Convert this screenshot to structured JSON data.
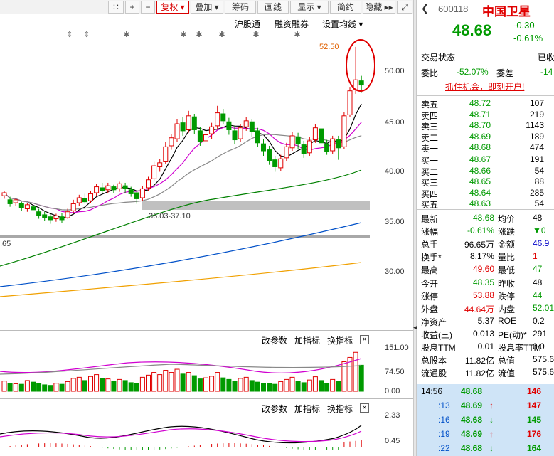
{
  "toolbar": {
    "buttons": [
      "+",
      "−",
      "复权 ▾",
      "叠加 ▾",
      "筹码",
      "画线",
      "显示 ▾",
      "简约",
      "隐藏 ▸▸"
    ],
    "menu_icon": "∷"
  },
  "chart_header": {
    "items": [
      "沪股通",
      "融资融券",
      "设置均线 ▾"
    ],
    "stars": [
      "⇕",
      "⇕",
      "✱",
      "✱",
      "✱",
      "✱",
      "✱",
      "✱"
    ]
  },
  "price_chart": {
    "y_ticks": [
      "50.00",
      "45.00",
      "40.00",
      "35.00",
      "30.00"
    ],
    "high_label": "52.50",
    "range_label": "36.03-37.10",
    "left_label": ".65"
  },
  "volume_panel": {
    "buttons": [
      "改参数",
      "加指标",
      "换指标"
    ],
    "close": "×",
    "y_ticks": [
      "151.00",
      "74.50",
      "0.00"
    ]
  },
  "macd_panel": {
    "buttons": [
      "改参数",
      "加指标",
      "换指标"
    ],
    "close": "×",
    "y_ticks": [
      "2.33",
      "0.45"
    ]
  },
  "stock": {
    "code": "600118",
    "name": "中国卫星",
    "price": "48.68",
    "change": "-0.30",
    "change_pct": "-0.61%"
  },
  "status": {
    "label": "交易状态",
    "value": "已收",
    "weibi_label": "委比",
    "weibi": "-52.07%",
    "weicha_label": "委差",
    "weicha": "-14",
    "promo": "抓住机会，即刻开户!"
  },
  "order_book": {
    "sell": [
      {
        "label": "卖五",
        "price": "48.72",
        "vol": "107"
      },
      {
        "label": "卖四",
        "price": "48.71",
        "vol": "219"
      },
      {
        "label": "卖三",
        "price": "48.70",
        "vol": "1143"
      },
      {
        "label": "卖二",
        "price": "48.69",
        "vol": "189"
      },
      {
        "label": "卖一",
        "price": "48.68",
        "vol": "474"
      }
    ],
    "buy": [
      {
        "label": "买一",
        "price": "48.67",
        "vol": "191"
      },
      {
        "label": "买二",
        "price": "48.66",
        "vol": "54"
      },
      {
        "label": "买三",
        "price": "48.65",
        "vol": "88"
      },
      {
        "label": "买四",
        "price": "48.64",
        "vol": "285"
      },
      {
        "label": "买五",
        "price": "48.63",
        "vol": "54"
      }
    ]
  },
  "stats": [
    {
      "l1": "最新",
      "v1": "48.68",
      "c1": "green",
      "l2": "均价",
      "v2": "48",
      "c2": "black"
    },
    {
      "l1": "涨幅",
      "v1": "-0.61%",
      "c1": "green",
      "l2": "涨跌",
      "v2": "▼0",
      "c2": "green"
    },
    {
      "l1": "总手",
      "v1": "96.65万",
      "c1": "black",
      "l2": "金额",
      "v2": "46.9",
      "c2": "blue"
    },
    {
      "l1": "换手*",
      "v1": "8.17%",
      "c1": "black",
      "l2": "量比",
      "v2": "1",
      "c2": "red"
    },
    {
      "l1": "最高",
      "v1": "49.60",
      "c1": "red",
      "l2": "最低",
      "v2": "47",
      "c2": "green"
    },
    {
      "l1": "今开",
      "v1": "48.35",
      "c1": "green",
      "l2": "昨收",
      "v2": "48",
      "c2": "black"
    },
    {
      "l1": "涨停",
      "v1": "53.88",
      "c1": "red",
      "l2": "跌停",
      "v2": "44",
      "c2": "green"
    },
    {
      "l1": "外盘",
      "v1": "44.64万",
      "c1": "red",
      "l2": "内盘",
      "v2": "52.01",
      "c2": "green"
    },
    {
      "l1": "净资产",
      "v1": "5.37",
      "c1": "black",
      "l2": "ROE",
      "v2": "0.2",
      "c2": "black"
    },
    {
      "l1": "收益(三)",
      "v1": "0.013",
      "c1": "black",
      "l2": "PE(动)*",
      "v2": "291",
      "c2": "black"
    },
    {
      "l1": "股息TTM",
      "v1": "0.01",
      "c1": "black",
      "l2": "股息率TTM",
      "v2": "0.0",
      "c2": "black"
    },
    {
      "l1": "总股本",
      "v1": "11.82亿",
      "c1": "black",
      "l2": "总值",
      "v2": "575.6",
      "c2": "black"
    },
    {
      "l1": "流通股",
      "v1": "11.82亿",
      "c1": "black",
      "l2": "流值",
      "v2": "575.6",
      "c2": "black"
    }
  ],
  "ticks": [
    {
      "time": "14:56",
      "price": "48.68",
      "arrow": "",
      "vol": "146"
    },
    {
      "time": ":13",
      "price": "48.69",
      "arrow": "↑",
      "vol": "147"
    },
    {
      "time": ":16",
      "price": "48.68",
      "arrow": "↓",
      "vol": "145"
    },
    {
      "time": ":19",
      "price": "48.69",
      "arrow": "↑",
      "vol": "176"
    },
    {
      "time": ":22",
      "price": "48.68",
      "arrow": "↓",
      "vol": "164"
    }
  ],
  "colors": {
    "up": "#e00000",
    "down": "#009a00",
    "ma5": "#000000",
    "ma10": "#d000d0",
    "ma20": "#888888",
    "ma30": "#008000",
    "ma60": "#0050c8",
    "ma120": "#f0a000"
  }
}
